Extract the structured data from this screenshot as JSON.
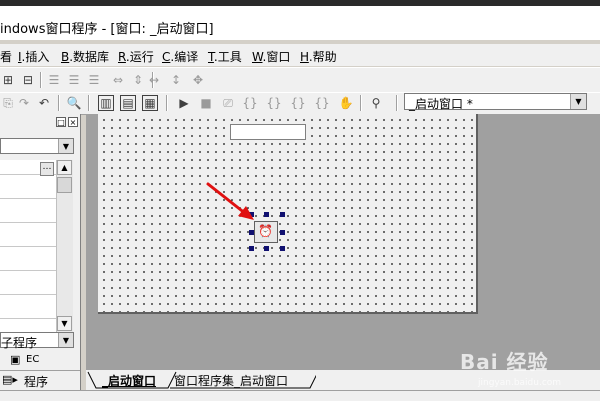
{
  "window": {
    "title": "indows窗口程序 - [窗口: _启动窗口]"
  },
  "menu": {
    "items": [
      {
        "key": "",
        "label": "看"
      },
      {
        "key": "I",
        "label": ".插入"
      },
      {
        "key": "B",
        "label": ".数据库"
      },
      {
        "key": "R",
        "label": ".运行"
      },
      {
        "key": "C",
        "label": ".编译"
      },
      {
        "key": "T",
        "label": ".工具"
      },
      {
        "key": "W",
        "label": ".窗口"
      },
      {
        "key": "H",
        "label": ".帮助"
      }
    ]
  },
  "toolbar": {
    "window_select_value": "_启动窗口 *"
  },
  "left_panel": {
    "sub_combo_value": "子程序",
    "ec_label": "EC",
    "program_tab_label": "程序",
    "dots_button": "…"
  },
  "bottom_tabs": [
    {
      "label": "_启动窗口"
    },
    {
      "label": "窗口程序集_启动窗口"
    }
  ],
  "watermark": {
    "text": "Bai  经验",
    "url": "jingyan.baidu.com"
  },
  "colors": {
    "arrow": "#e01010",
    "handle": "#101070",
    "design_bg": "#a0a0a0"
  }
}
